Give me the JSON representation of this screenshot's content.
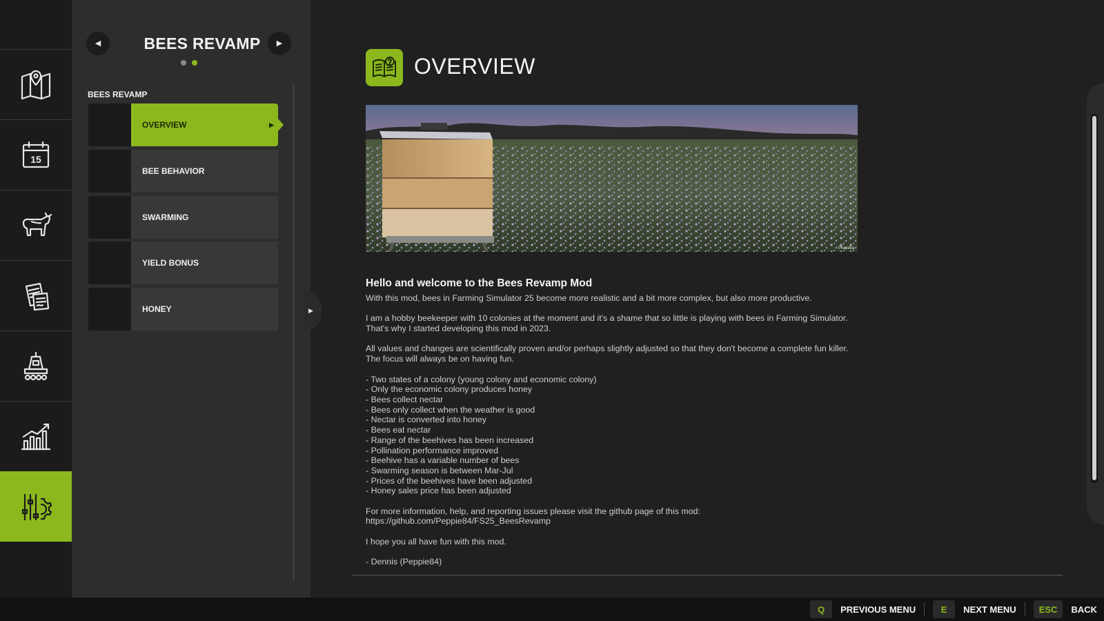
{
  "rail": {
    "items": [
      {
        "icon": "map-icon"
      },
      {
        "icon": "calendar-icon",
        "text": "15"
      },
      {
        "icon": "animals-icon"
      },
      {
        "icon": "contracts-icon"
      },
      {
        "icon": "production-icon"
      },
      {
        "icon": "statistics-icon"
      },
      {
        "icon": "settings-icon",
        "active": true
      }
    ]
  },
  "subpanel": {
    "title": "BEES REVAMP",
    "prev_icon": "◀",
    "next_icon": "▶",
    "page_dots": 2,
    "active_dot": 2,
    "section_label": "BEES REVAMP",
    "items": [
      {
        "label": "OVERVIEW",
        "selected": true
      },
      {
        "label": "BEE BEHAVIOR"
      },
      {
        "label": "SWARMING"
      },
      {
        "label": "YIELD BONUS"
      },
      {
        "label": "HONEY"
      }
    ],
    "collapse_icon": "▶"
  },
  "main": {
    "title": "OVERVIEW",
    "hero_credit": "Phacelia",
    "heading": "Hello and welcome to the Bees Revamp Mod",
    "intro": "With this mod, bees in Farming Simulator 25 become more realistic and a bit more complex, but also more productive.",
    "para1": "I am a hobby beekeeper with 10 colonies at the moment and it's a shame that so little is playing with bees in Farming Simulator. That's why I started developing this mod in 2023.",
    "para2": "All values and changes are scientifically proven and/or perhaps slightly adjusted so that they don't become a complete fun killer. The focus will always be on having fun.",
    "features": [
      "- Two states of a colony (young colony and economic colony)",
      "- Only the economic colony produces honey",
      "- Bees collect nectar",
      "- Bees only collect when the weather is good",
      "- Nectar is converted into honey",
      "- Bees eat nectar",
      "- Range of the beehives has been increased",
      "- Pollination performance improved",
      "- Beehive has a variable number of bees",
      "- Swarming season is between Mar-Jul",
      "- Prices of the beehives have been adjusted",
      "- Honey sales price has been adjusted"
    ],
    "info_line": "For more information, help, and reporting issues please visit the github page of this mod:",
    "github_url": "https://github.com/Peppie84/FS25_BeesRevamp",
    "closing": "I hope you all have fun with this mod.",
    "signature": "- Dennis (Peppie84)"
  },
  "footer": {
    "hints": [
      {
        "key": "Q",
        "label": "PREVIOUS MENU"
      },
      {
        "key": "E",
        "label": "NEXT MENU"
      },
      {
        "key": "ESC",
        "label": "BACK"
      }
    ]
  },
  "colors": {
    "accent": "#8cb81e",
    "background": "#202020",
    "panel": "#2d2d2d",
    "rail": "#1b1b1b"
  }
}
